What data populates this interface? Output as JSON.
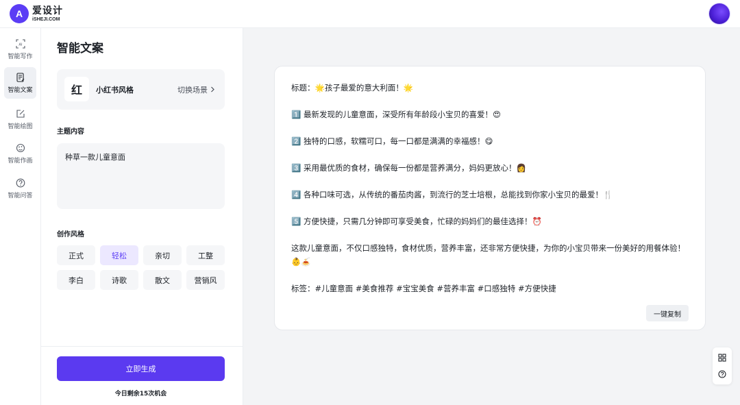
{
  "brand": {
    "logo_mark": "A",
    "name_cn": "爱设计",
    "name_en": "iSHEJI.COM"
  },
  "nav": {
    "items": [
      {
        "label": "智能写作",
        "icon": "ai-write-icon"
      },
      {
        "label": "智能文案",
        "icon": "copywriting-icon",
        "active": true
      },
      {
        "label": "智能绘图",
        "icon": "drawing-icon"
      },
      {
        "label": "智能作画",
        "icon": "painting-icon"
      },
      {
        "label": "智能问答",
        "icon": "question-icon"
      }
    ]
  },
  "panel": {
    "title": "智能文案",
    "scene": {
      "icon_char": "红",
      "name": "小红书风格",
      "switch_label": "切换场景"
    },
    "topic": {
      "label": "主题内容",
      "value": "种草一款儿童意面"
    },
    "style": {
      "label": "创作风格",
      "options": [
        "正式",
        "轻松",
        "亲切",
        "工整",
        "李白",
        "诗歌",
        "散文",
        "营销风"
      ],
      "selected": "轻松"
    },
    "generate_label": "立即生成",
    "remaining_text": "今日剩余15次机会"
  },
  "result": {
    "lines": [
      "标题：🌟孩子最爱的意大利面！🌟",
      "1️⃣ 最新发现的儿童意面，深受所有年龄段小宝贝的喜爱！😍",
      "2️⃣ 独特的口感，软糯可口，每一口都是满满的幸福感！😋",
      "3️⃣ 采用最优质的食材，确保每一份都是营养满分，妈妈更放心！👩",
      "4️⃣ 各种口味可选，从传统的番茄肉酱，到流行的芝士培根，总能找到你家小宝贝的最爱！🍴",
      "5️⃣ 方便快捷，只需几分钟即可享受美食，忙碌的妈妈们的最佳选择！⏰",
      "这款儿童意面，不仅口感独特，食材优质，营养丰富，还非常方便快捷，为你的小宝贝带来一份美好的用餐体验！👶🍝",
      "标签：#儿童意面 #美食推荐 #宝宝美食 #营养丰富 #口感独特 #方便快捷"
    ],
    "copy_label": "一键复制"
  },
  "tools": {
    "grid_icon": "grid-icon",
    "help_icon": "help-icon"
  },
  "colors": {
    "accent": "#5b3af0",
    "selected_bg": "#ece8ff",
    "page_bg": "#f3f4f6"
  }
}
